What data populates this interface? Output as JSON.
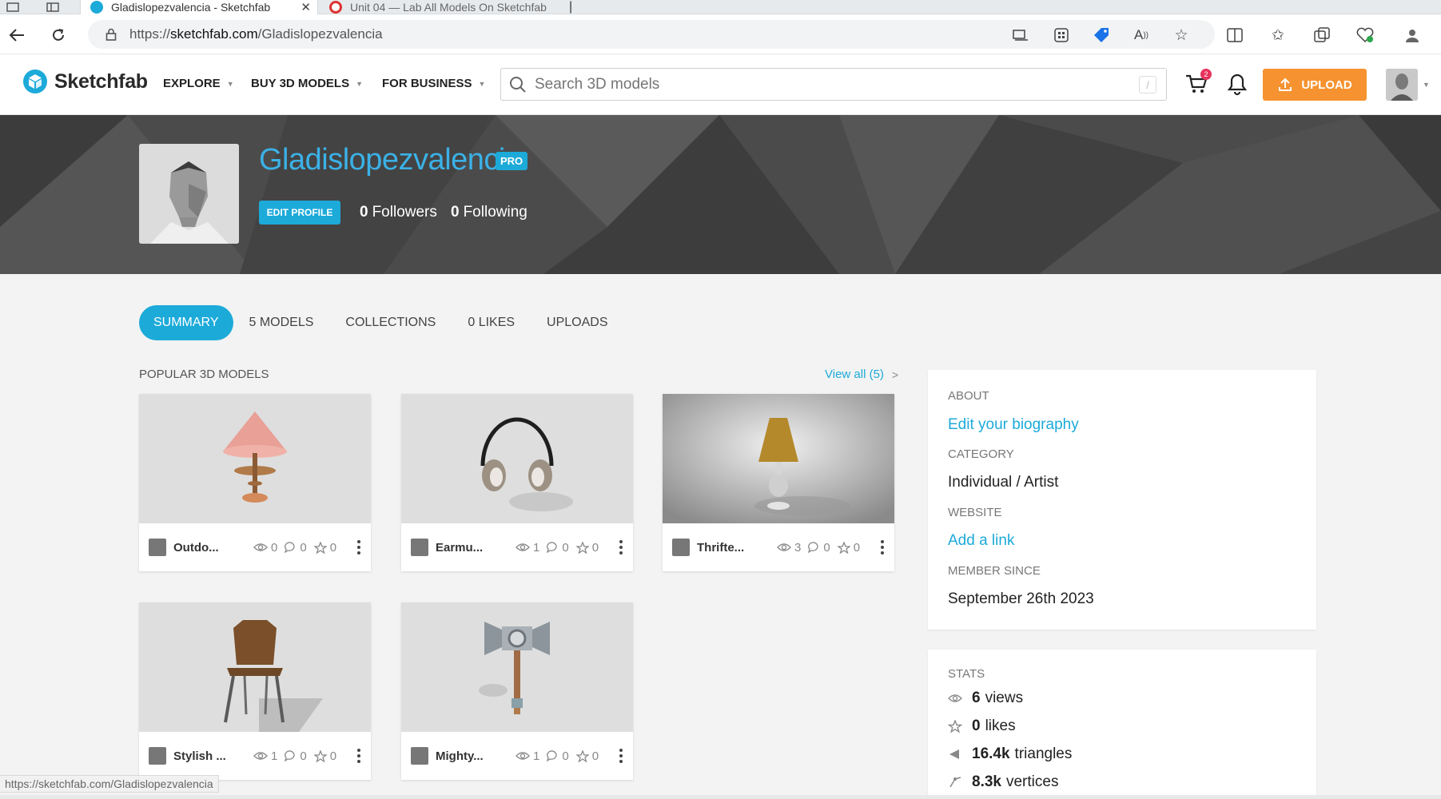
{
  "browser": {
    "tabs": [
      {
        "title": "Gladislopezvalencia - Sketchfab",
        "active": true
      },
      {
        "title": "Unit 04 — Lab All Models On Sketchfab",
        "active": false
      }
    ],
    "url_prefix": "https://",
    "url_host": "sketchfab.com",
    "url_path": "/Gladislopezvalencia",
    "status_url": "https://sketchfab.com/Gladislopezvalencia"
  },
  "header": {
    "brand": "Sketchfab",
    "nav": [
      "EXPLORE",
      "BUY 3D MODELS",
      "FOR BUSINESS"
    ],
    "search_placeholder": "Search 3D models",
    "search_shortcut": "/",
    "cart_count": "2",
    "upload_label": "UPLOAD",
    "colors": {
      "accent": "#1caad9",
      "upload": "#f69330"
    }
  },
  "profile": {
    "name": "Gladislopezvalencia",
    "badge": "PRO",
    "edit_label": "EDIT PROFILE",
    "followers_count": "0",
    "followers_label": "Followers",
    "following_count": "0",
    "following_label": "Following"
  },
  "tabs": [
    "SUMMARY",
    "5 MODELS",
    "COLLECTIONS",
    "0 LIKES",
    "UPLOADS"
  ],
  "popular": {
    "title": "POPULAR 3D MODELS",
    "view_all": "View all (5)",
    "models": [
      {
        "name": "Outdo...",
        "views": "0",
        "comments": "0",
        "likes": "0",
        "icon": "pink-lamp"
      },
      {
        "name": "Earmu...",
        "views": "1",
        "comments": "0",
        "likes": "0",
        "icon": "earmuffs"
      },
      {
        "name": "Thrifte...",
        "views": "3",
        "comments": "0",
        "likes": "0",
        "icon": "straw-lamp"
      },
      {
        "name": "Stylish ...",
        "views": "1",
        "comments": "0",
        "likes": "0",
        "icon": "wooden-chair"
      },
      {
        "name": "Mighty...",
        "views": "1",
        "comments": "0",
        "likes": "0",
        "icon": "hammer"
      }
    ]
  },
  "about": {
    "about_label": "ABOUT",
    "bio_link": "Edit your biography",
    "category_label": "CATEGORY",
    "category": "Individual / Artist",
    "website_label": "WEBSITE",
    "website_link": "Add a link",
    "member_label": "MEMBER SINCE",
    "member_since": "September 26th 2023"
  },
  "stats": {
    "label": "STATS",
    "views_num": "6",
    "views_unit": "views",
    "likes_num": "0",
    "likes_unit": "likes",
    "triangles_num": "16.4k",
    "triangles_unit": "triangles",
    "vertices_num": "8.3k",
    "vertices_unit": "vertices"
  }
}
